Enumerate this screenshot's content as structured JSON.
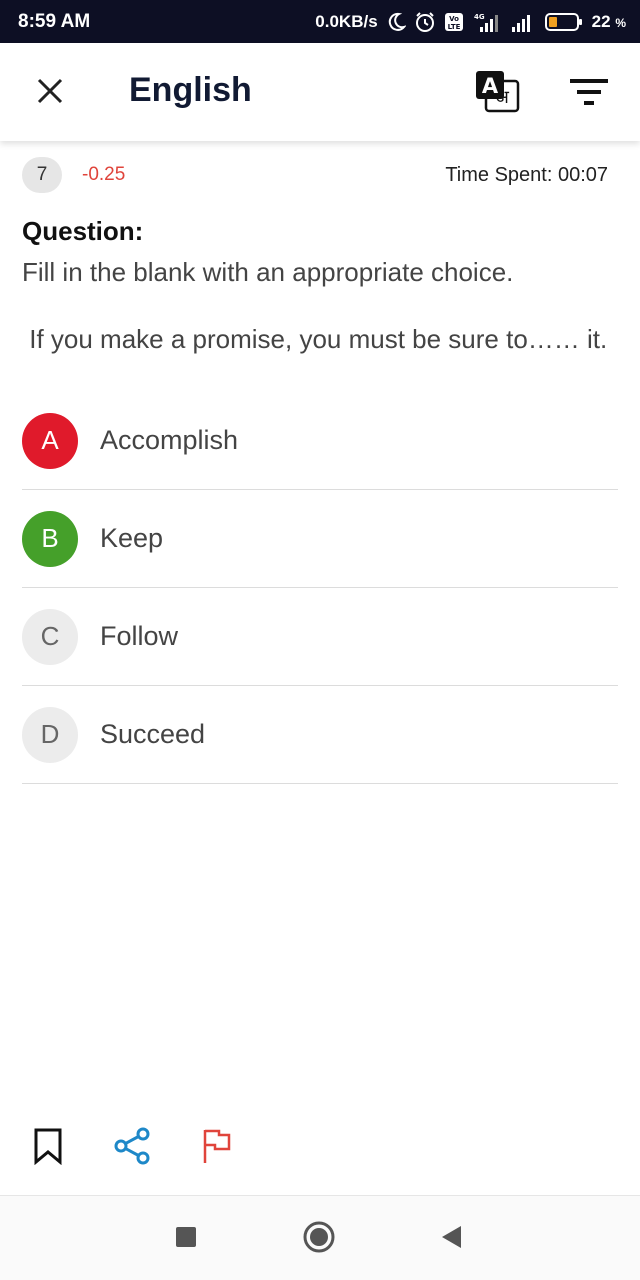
{
  "status_bar": {
    "time": "8:59 AM",
    "net_speed": "0.0KB/s",
    "network_label": "4G",
    "volte_label": "Vo LTE",
    "battery_percent": "22",
    "battery_unit": "%"
  },
  "header": {
    "title": "English",
    "close_icon": "close-icon",
    "translate_icon": "translate-icon",
    "filter_icon": "filter-icon"
  },
  "question_meta": {
    "number": "7",
    "negative_marks": "-0.25",
    "time_spent": "Time Spent: 00:07"
  },
  "question": {
    "heading": "Question:",
    "instruction": "Fill in the blank with an appropriate choice.",
    "sentence": " If you make a promise, you must be sure to…… it."
  },
  "options": [
    {
      "letter": "A",
      "text": "Accomplish",
      "state": "wrong"
    },
    {
      "letter": "B",
      "text": "Keep",
      "state": "correct"
    },
    {
      "letter": "C",
      "text": "Follow",
      "state": "neutral"
    },
    {
      "letter": "D",
      "text": "Succeed",
      "state": "neutral"
    }
  ],
  "colors": {
    "wrong": "#e01a2b",
    "correct": "#45a02a",
    "negative_mark": "#e0443b",
    "share": "#1e88c8",
    "report": "#e0443b"
  },
  "actions": [
    "bookmark-icon",
    "share-icon",
    "report-flag-icon"
  ],
  "nav": [
    "recents-icon",
    "home-icon",
    "back-icon"
  ]
}
